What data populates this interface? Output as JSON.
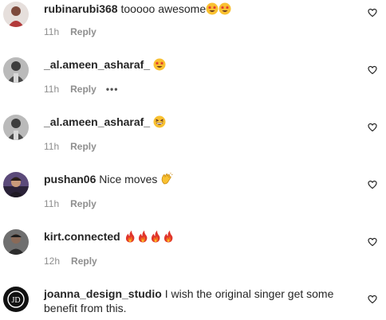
{
  "comments": [
    {
      "username": "rubinarubi368",
      "text": "tooooo awesome",
      "emoji_icons": [
        "star-struck-emoji-icon",
        "star-struck-emoji-icon"
      ],
      "time": "11h",
      "reply_label": "Reply"
    },
    {
      "username": "_al.ameen_asharaf_",
      "text": "",
      "emoji_icons": [
        "star-struck-emoji-icon"
      ],
      "time": "11h",
      "reply_label": "Reply",
      "more_label": "•••"
    },
    {
      "username": "_al.ameen_asharaf_",
      "text": "",
      "emoji_icons": [
        "grinning-squinting-emoji-icon"
      ],
      "time": "11h",
      "reply_label": "Reply"
    },
    {
      "username": "pushan06",
      "text": "Nice moves",
      "emoji_icons": [
        "clapping-hands-emoji-icon"
      ],
      "time": "11h",
      "reply_label": "Reply"
    },
    {
      "username": "kirt.connected",
      "text": "",
      "emoji_icons": [
        "fire-emoji-icon",
        "fire-emoji-icon",
        "fire-emoji-icon",
        "fire-emoji-icon"
      ],
      "time": "12h",
      "reply_label": "Reply"
    },
    {
      "username": "joanna_design_studio",
      "text": "I wish the original singer get some benefit from this.",
      "emoji_icons": [],
      "avatar_initials": "JD"
    }
  ],
  "colors": {
    "username": "#262626",
    "meta": "#8e8e8e",
    "emoji_yellow": "#f9c131",
    "emoji_red": "#e0342b",
    "fire_orange": "#f4701c"
  }
}
